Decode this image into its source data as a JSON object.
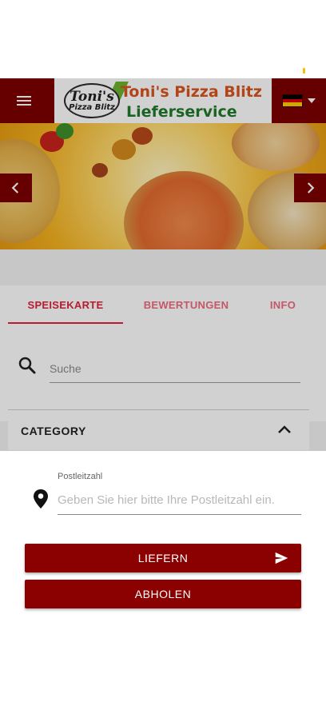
{
  "header": {
    "logo_badge_top": "Toni's",
    "logo_badge_bottom": "Pizza Blitz",
    "logo_title": "Toni's Pizza Blitz",
    "logo_subtitle": "Lieferservice",
    "menu_icon": "hamburger-menu-icon",
    "language_flag": "germany-flag-icon",
    "language_caret": "caret-down-icon",
    "brand_color": "#7d0000"
  },
  "banner": {
    "prev_icon": "chevron-left-icon",
    "next_icon": "chevron-right-icon"
  },
  "tabs": [
    {
      "label": "SPEISEKARTE",
      "active": true
    },
    {
      "label": "BEWERTUNGEN",
      "active": false
    },
    {
      "label": "INFO",
      "active": false
    }
  ],
  "search": {
    "placeholder": "Suche",
    "value": "",
    "icon": "search-icon"
  },
  "category": {
    "title": "CATEGORY",
    "icon": "chevron-up-icon"
  },
  "delivery_sheet": {
    "postal_label": "Postleitzahl",
    "postal_placeholder": "Geben Sie hier bitte Ihre Postleitzahl ein.",
    "postal_value": "",
    "location_icon": "location-pin-icon",
    "deliver_label": "LIEFERN",
    "deliver_icon": "send-icon",
    "pickup_label": "ABHOLEN",
    "button_color": "#8b0000"
  },
  "colors": {
    "accent": "#e0233b",
    "tab_inactive": "#ef6b7f"
  }
}
